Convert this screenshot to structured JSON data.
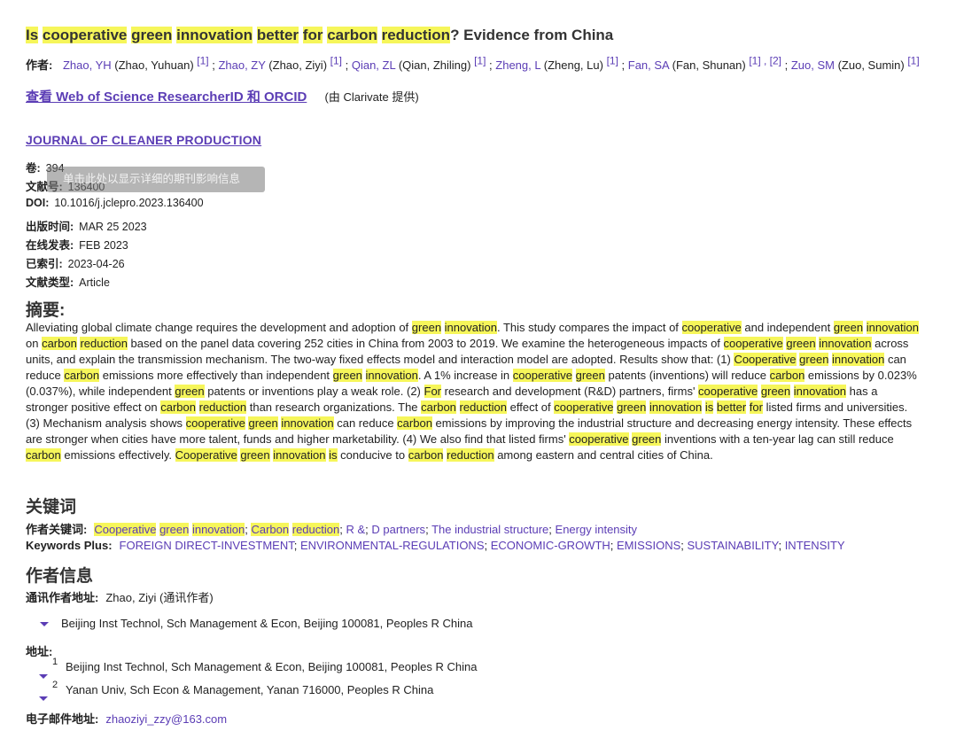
{
  "title": {
    "words": [
      "Is",
      "cooperative",
      "green",
      "innovation",
      "better",
      "for",
      "carbon",
      "reduction"
    ],
    "rest": "? Evidence from China"
  },
  "authors": {
    "label": "作者:",
    "list": [
      {
        "abbr": "Zhao, YH",
        "full": "(Zhao, Yuhuan)",
        "refs": "[1]"
      },
      {
        "abbr": "Zhao, ZY",
        "full": "(Zhao, Ziyi)",
        "refs": "[1]"
      },
      {
        "abbr": "Qian, ZL",
        "full": "(Qian, Zhiling)",
        "refs": "[1]"
      },
      {
        "abbr": "Zheng, L",
        "full": "(Zheng, Lu)",
        "refs": "[1]"
      },
      {
        "abbr": "Fan, SA",
        "full": "(Fan, Shunan)",
        "refs": "[1] , [2]"
      },
      {
        "abbr": "Zuo, SM",
        "full": "(Zuo, Sumin)",
        "refs": "[1]"
      }
    ]
  },
  "researcher": {
    "link": "查看 Web of Science ResearcherID 和 ORCID",
    "by": "(由 Clarivate 提供)"
  },
  "journal": "JOURNAL OF CLEANER PRODUCTION",
  "tooltip": "单击此处以显示详细的期刊影响信息",
  "meta": {
    "volume": {
      "k": "卷:",
      "v": "394"
    },
    "article_no": {
      "k": "文献号:",
      "v": "136400"
    },
    "doi": {
      "k": "DOI:",
      "v": "10.1016/j.jclepro.2023.136400"
    },
    "published": {
      "k": "出版时间:",
      "v": "MAR 25 2023"
    },
    "online": {
      "k": "在线发表:",
      "v": "FEB 2023"
    },
    "indexed": {
      "k": "已索引:",
      "v": "2023-04-26"
    },
    "doc_type": {
      "k": "文献类型:",
      "v": "Article"
    }
  },
  "abstract": {
    "heading": "摘要:",
    "segments": [
      [
        "Alleviating global climate change requires the development and adoption of ",
        0
      ],
      [
        "green",
        1
      ],
      [
        " ",
        0
      ],
      [
        "innovation",
        1
      ],
      [
        ". This study compares the impact of ",
        0
      ],
      [
        "cooperative",
        1
      ],
      [
        " and independent ",
        0
      ],
      [
        "green",
        1
      ],
      [
        " ",
        0
      ],
      [
        "innovation",
        1
      ],
      [
        " on ",
        0
      ],
      [
        "carbon",
        1
      ],
      [
        " ",
        0
      ],
      [
        "reduction",
        1
      ],
      [
        " based on the panel data covering 252 cities in China from 2003 to 2019. We examine the heterogeneous impacts of ",
        0
      ],
      [
        "cooperative",
        1
      ],
      [
        " ",
        0
      ],
      [
        "green",
        1
      ],
      [
        " ",
        0
      ],
      [
        "innovation",
        1
      ],
      [
        " across units, and explain the transmission mechanism. The two-way fixed effects model and interaction model are adopted. Results show that: (1) ",
        0
      ],
      [
        "Cooperative",
        1
      ],
      [
        " ",
        0
      ],
      [
        "green",
        1
      ],
      [
        " ",
        0
      ],
      [
        "innovation",
        1
      ],
      [
        " can reduce ",
        0
      ],
      [
        "carbon",
        1
      ],
      [
        " emissions more effectively than independent ",
        0
      ],
      [
        "green",
        1
      ],
      [
        " ",
        0
      ],
      [
        "innovation",
        1
      ],
      [
        ". A 1% increase in ",
        0
      ],
      [
        "cooperative",
        1
      ],
      [
        " ",
        0
      ],
      [
        "green",
        1
      ],
      [
        " patents (inventions) will reduce ",
        0
      ],
      [
        "carbon",
        1
      ],
      [
        " emissions by 0.023% (0.037%), while independent ",
        0
      ],
      [
        "green",
        1
      ],
      [
        " patents or inventions play a weak role. (2) ",
        0
      ],
      [
        "For",
        1
      ],
      [
        " research and development (R&D) partners, firms' ",
        0
      ],
      [
        "cooperative",
        1
      ],
      [
        " ",
        0
      ],
      [
        "green",
        1
      ],
      [
        " ",
        0
      ],
      [
        "innovation",
        1
      ],
      [
        " has a stronger positive effect on ",
        0
      ],
      [
        "carbon",
        1
      ],
      [
        " ",
        0
      ],
      [
        "reduction",
        1
      ],
      [
        " than research organizations. The ",
        0
      ],
      [
        "carbon",
        1
      ],
      [
        " ",
        0
      ],
      [
        "reduction",
        1
      ],
      [
        " effect of ",
        0
      ],
      [
        "cooperative",
        1
      ],
      [
        " ",
        0
      ],
      [
        "green",
        1
      ],
      [
        " ",
        0
      ],
      [
        "innovation",
        1
      ],
      [
        " ",
        0
      ],
      [
        "is",
        1
      ],
      [
        " ",
        0
      ],
      [
        "better",
        1
      ],
      [
        " ",
        0
      ],
      [
        "for",
        1
      ],
      [
        " listed firms and universities. (3) Mechanism analysis shows ",
        0
      ],
      [
        "cooperative",
        1
      ],
      [
        " ",
        0
      ],
      [
        "green",
        1
      ],
      [
        " ",
        0
      ],
      [
        "innovation",
        1
      ],
      [
        " can reduce ",
        0
      ],
      [
        "carbon",
        1
      ],
      [
        " emissions by improving the industrial structure and decreasing energy intensity. These effects are stronger when cities have more talent, funds and higher marketability. (4) We also find that listed firms' ",
        0
      ],
      [
        "cooperative",
        1
      ],
      [
        " ",
        0
      ],
      [
        "green",
        1
      ],
      [
        " inventions with a ten-year lag can still reduce ",
        0
      ],
      [
        "carbon",
        1
      ],
      [
        " emissions effectively. ",
        0
      ],
      [
        "Cooperative",
        1
      ],
      [
        " ",
        0
      ],
      [
        "green",
        1
      ],
      [
        " ",
        0
      ],
      [
        "innovation",
        1
      ],
      [
        " ",
        0
      ],
      [
        "is",
        1
      ],
      [
        " conducive to ",
        0
      ],
      [
        "carbon",
        1
      ],
      [
        " ",
        0
      ],
      [
        "reduction",
        1
      ],
      [
        " among eastern and central cities of China.",
        0
      ]
    ]
  },
  "keywords": {
    "heading": "关键词",
    "author_label": "作者关键词:",
    "author_kw": [
      {
        "parts": [
          [
            "Cooperative",
            1
          ],
          [
            " ",
            0
          ],
          [
            "green",
            1
          ],
          [
            " ",
            0
          ],
          [
            "innovation",
            1
          ]
        ]
      },
      {
        "parts": [
          [
            "Carbon",
            1
          ],
          [
            " ",
            0
          ],
          [
            "reduction",
            1
          ]
        ]
      },
      {
        "parts": [
          [
            "R &",
            0
          ]
        ]
      },
      {
        "parts": [
          [
            "D partners",
            0
          ]
        ]
      },
      {
        "parts": [
          [
            "The industrial structure",
            0
          ]
        ]
      },
      {
        "parts": [
          [
            "Energy intensity",
            0
          ]
        ]
      }
    ],
    "plus_label": "Keywords Plus:",
    "plus_kw": [
      "FOREIGN DIRECT-INVESTMENT",
      "ENVIRONMENTAL-REGULATIONS",
      "ECONOMIC-GROWTH",
      "EMISSIONS",
      "SUSTAINABILITY",
      "INTENSITY"
    ]
  },
  "author_info": {
    "heading": "作者信息",
    "corr_label": "通讯作者地址:",
    "corr_name": "Zhao, Ziyi (通讯作者)",
    "corr_addr": "Beijing Inst Technol, Sch Management & Econ, Beijing 100081, Peoples R China",
    "addr_label": "地址:",
    "addresses": [
      {
        "num": "1",
        "text": "Beijing Inst Technol, Sch Management & Econ, Beijing 100081, Peoples R China"
      },
      {
        "num": "2",
        "text": "Yanan Univ, Sch Econ & Management, Yanan 716000, Peoples R China"
      }
    ],
    "email_label": "电子邮件地址:",
    "email": "zhaoziyi_zzy@163.com"
  },
  "colors": {
    "link": "#5b3db5",
    "highlight": "#f6f65a"
  }
}
